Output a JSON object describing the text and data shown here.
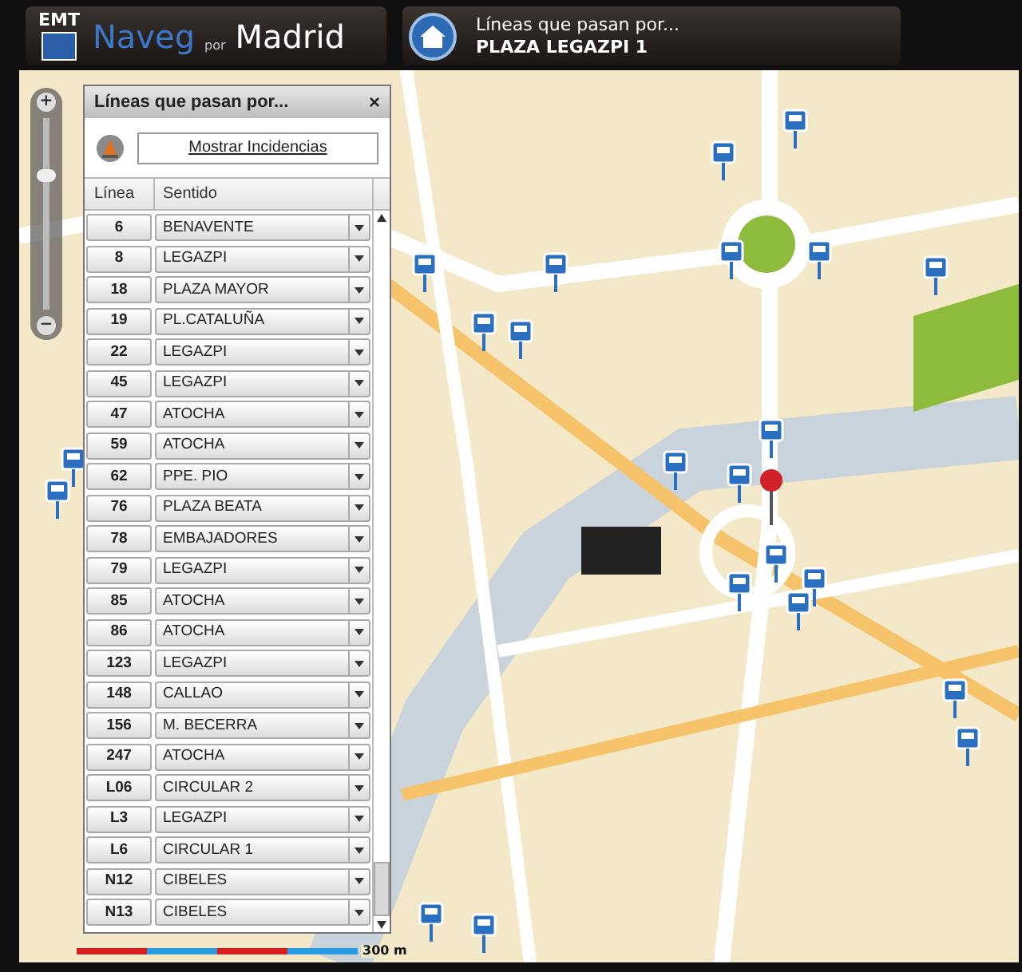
{
  "header": {
    "logo_top": "EMT",
    "logo_left": "Naveg",
    "logo_small": "por",
    "logo_right": "Madrid",
    "title": "Líneas que pasan por...",
    "subtitle": "PLAZA LEGAZPI 1"
  },
  "zoom": {
    "plus": "+",
    "minus": "−",
    "level": 0.7
  },
  "panel": {
    "title": "Líneas que pasan por...",
    "close": "×",
    "incidents_button": "Mostrar Incidencias",
    "columns": [
      "Línea",
      "Sentido"
    ],
    "rows": [
      {
        "line": "6",
        "direction": "BENAVENTE"
      },
      {
        "line": "8",
        "direction": "LEGAZPI"
      },
      {
        "line": "18",
        "direction": "PLAZA MAYOR"
      },
      {
        "line": "19",
        "direction": "PL.CATALUÑA"
      },
      {
        "line": "22",
        "direction": "LEGAZPI"
      },
      {
        "line": "45",
        "direction": "LEGAZPI"
      },
      {
        "line": "47",
        "direction": "ATOCHA"
      },
      {
        "line": "59",
        "direction": "ATOCHA"
      },
      {
        "line": "62",
        "direction": "PPE. PIO"
      },
      {
        "line": "76",
        "direction": "PLAZA BEATA"
      },
      {
        "line": "78",
        "direction": "EMBAJADORES"
      },
      {
        "line": "79",
        "direction": "LEGAZPI"
      },
      {
        "line": "85",
        "direction": "ATOCHA"
      },
      {
        "line": "86",
        "direction": "ATOCHA"
      },
      {
        "line": "123",
        "direction": "LEGAZPI"
      },
      {
        "line": "148",
        "direction": "CALLAO"
      },
      {
        "line": "156",
        "direction": "M. BECERRA"
      },
      {
        "line": "247",
        "direction": "ATOCHA"
      },
      {
        "line": "L06",
        "direction": "CIRCULAR 2"
      },
      {
        "line": "L3",
        "direction": "LEGAZPI"
      },
      {
        "line": "L6",
        "direction": "CIRCULAR 1"
      },
      {
        "line": "N12",
        "direction": "CIBELES"
      },
      {
        "line": "N13",
        "direction": "CIBELES"
      }
    ]
  },
  "scale": {
    "label": "300 m"
  }
}
